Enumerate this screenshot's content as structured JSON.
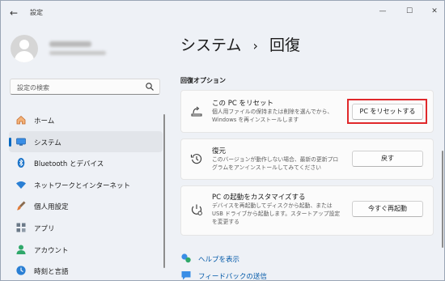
{
  "window": {
    "app_title": "設定"
  },
  "sidebar": {
    "search_placeholder": "設定の検索",
    "items": [
      {
        "label": "ホーム",
        "icon": "home-icon",
        "active": false
      },
      {
        "label": "システム",
        "icon": "system-icon",
        "active": true
      },
      {
        "label": "Bluetooth とデバイス",
        "icon": "bluetooth-icon",
        "active": false
      },
      {
        "label": "ネットワークとインターネット",
        "icon": "wifi-icon",
        "active": false
      },
      {
        "label": "個人用設定",
        "icon": "brush-icon",
        "active": false
      },
      {
        "label": "アプリ",
        "icon": "apps-icon",
        "active": false
      },
      {
        "label": "アカウント",
        "icon": "account-icon",
        "active": false
      },
      {
        "label": "時刻と言語",
        "icon": "time-language-icon",
        "active": false
      }
    ]
  },
  "main": {
    "breadcrumb_parent": "システム",
    "breadcrumb_sep": "›",
    "breadcrumb_current": "回復",
    "section_title": "回復オプション",
    "cards": [
      {
        "title": "この PC をリセット",
        "desc": "個人用ファイルの保持または削除を選んでから、\nWindows を再インストールします",
        "button": "PC をリセットする"
      },
      {
        "title": "復元",
        "desc": "このバージョンが動作しない場合、最新の更新プロ\nグラムをアンインストールしてみてください",
        "button": "戻す"
      },
      {
        "title": "PC の起動をカスタマイズする",
        "desc": "デバイスを再起動してディスクから起動、または\nUSB ドライブから起動します。スタートアップ設定\nを変更する",
        "button": "今すぐ再起動"
      }
    ],
    "links": [
      {
        "label": "ヘルプを表示"
      },
      {
        "label": "フィードバックの送信"
      }
    ]
  },
  "colors": {
    "accent": "#0067c0",
    "highlight": "#e0282b",
    "link": "#0058a8"
  }
}
